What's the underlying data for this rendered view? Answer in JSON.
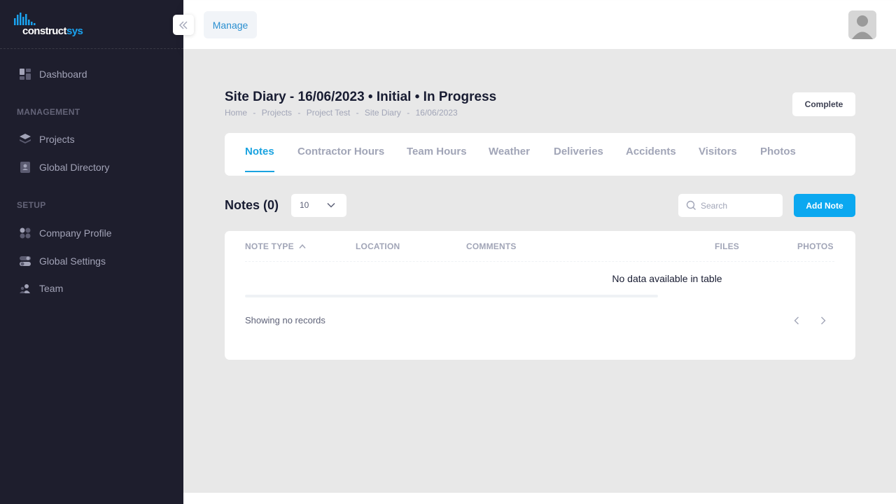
{
  "brand": {
    "name_part1": "construct",
    "name_part2": "sys",
    "accent_color": "#1aa3f0"
  },
  "sidebar": {
    "items_top": [
      {
        "label": "Dashboard",
        "icon": "dashboard-icon"
      }
    ],
    "sections": [
      {
        "title": "MANAGEMENT",
        "items": [
          {
            "label": "Projects",
            "icon": "layers-icon"
          },
          {
            "label": "Global Directory",
            "icon": "address-book-icon"
          }
        ]
      },
      {
        "title": "SETUP",
        "items": [
          {
            "label": "Company Profile",
            "icon": "building-icon"
          },
          {
            "label": "Global Settings",
            "icon": "toggle-icon"
          },
          {
            "label": "Team",
            "icon": "users-icon"
          }
        ]
      }
    ]
  },
  "header": {
    "manage_label": "Manage"
  },
  "page": {
    "title": "Site Diary - 16/06/2023 • Initial • In Progress",
    "breadcrumb": [
      "Home",
      "-",
      "Projects",
      "-",
      "Project Test",
      "-",
      "Site Diary",
      "-",
      "16/06/2023"
    ],
    "complete_label": "Complete"
  },
  "tabs": [
    "Notes",
    "Contractor Hours",
    "Team Hours",
    "Weather",
    "Deliveries",
    "Accidents",
    "Visitors",
    "Photos"
  ],
  "active_tab": "Notes",
  "notes": {
    "title": "Notes (0)",
    "per_page": "10",
    "search_placeholder": "Search",
    "add_label": "Add Note",
    "columns": [
      "NOTE TYPE",
      "LOCATION",
      "COMMENTS",
      "FILES",
      "PHOTOS"
    ],
    "sort_column": "NOTE TYPE",
    "empty_message": "No data available in table",
    "showing": "Showing no records"
  }
}
